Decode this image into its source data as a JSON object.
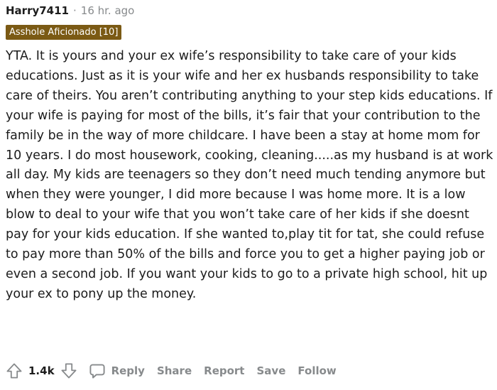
{
  "comment": {
    "author": "Harry7411",
    "separator": "·",
    "timestamp": "16 hr. ago",
    "flair": "Asshole Aficionado [10]",
    "body": "YTA. It is yours and your ex wife’s responsibility to take care of your kids educations. Just as it is your wife and her ex husbands responsibility to take care of theirs. You aren’t contributing anything to your step kids educations. If your wife is paying for most of the bills, it’s fair that your contribution to the family be in the way of more childcare. I have been a stay at home mom for 10 years. I do most housework, cooking, cleaning.....as my husband is at work all day. My kids are teenagers so they don’t need much tending anymore but when they were younger, I did more because I was home more. It is a low blow to deal to your wife that you won’t take care of her kids if she doesnt pay for your kids education. If she wanted to,play tit for tat, she could refuse to pay more than 50% of the bills and force you to get a higher paying job or even a second job. If you want your kids to go to a private high school, hit up your ex to pony up the money."
  },
  "actions": {
    "upvote_icon": "upvote-arrow-icon",
    "downvote_icon": "downvote-arrow-icon",
    "score": "1.4k",
    "reply_icon": "speech-bubble-icon",
    "reply": "Reply",
    "share": "Share",
    "report": "Report",
    "save": "Save",
    "follow": "Follow"
  },
  "colors": {
    "flair_background": "#7b5a14",
    "muted_text": "#878a8c",
    "body_text": "#1c1c1c"
  }
}
